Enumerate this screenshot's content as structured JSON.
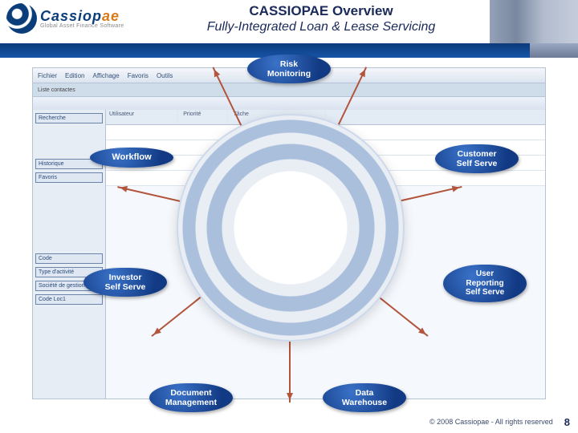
{
  "logo": {
    "brand": "Cassiop",
    "brand_accent": "ae",
    "tagline": "Global Asset Finance Software"
  },
  "header": {
    "title": "CASSIOPAE Overview",
    "subtitle": "Fully-Integrated Loan & Lease Servicing"
  },
  "bubbles": {
    "risk": "Risk\nMonitoring",
    "customer": "Customer\nSelf Serve",
    "workflow": "Workflow",
    "investor": "Investor\nSelf Serve",
    "user": "User\nReporting\nSelf Serve",
    "document": "Document\nManagement",
    "data": "Data\nWarehouse"
  },
  "app": {
    "menu": [
      "Fichier",
      "Edition",
      "Affichage",
      "Favoris",
      "Outils"
    ],
    "tabs": [
      "Liste contactes"
    ],
    "side_blocks": [
      "Recherche",
      "Historique",
      "Favoris"
    ],
    "cols": [
      "Utilisateur",
      "Priorité",
      "Tâche"
    ],
    "fields": [
      "Code",
      "Type d'activité",
      "Société de gestion",
      "Code Loc1"
    ]
  },
  "footer": {
    "copyright": "© 2008 Cassiopae - All rights reserved",
    "page": "8"
  }
}
